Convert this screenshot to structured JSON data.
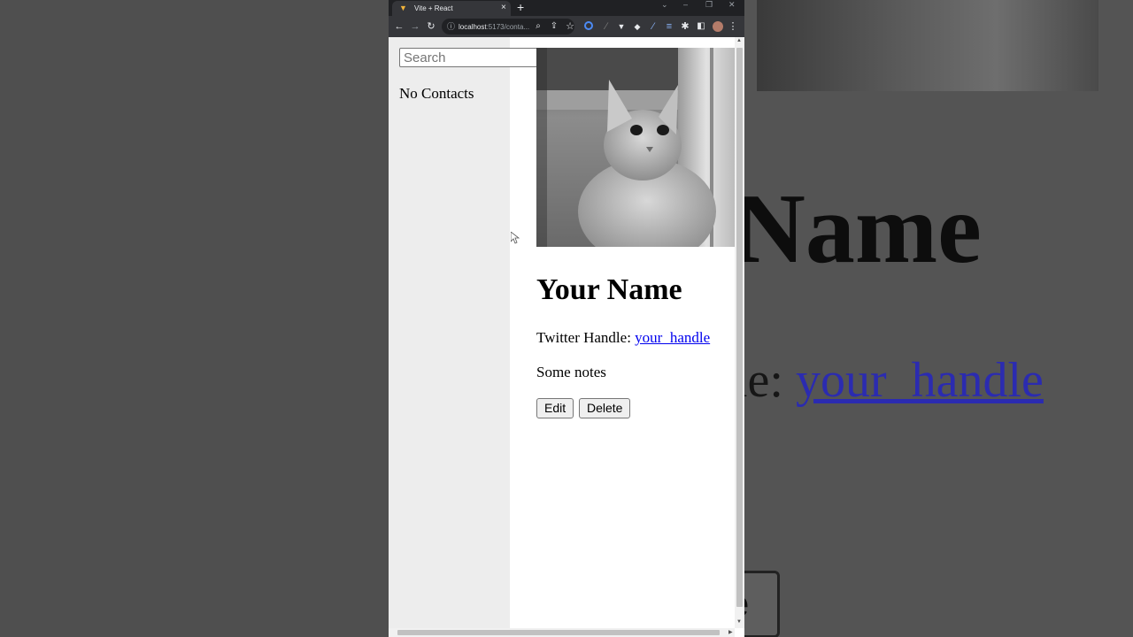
{
  "browser": {
    "tab_title": "Vite + React",
    "tab_close": "×",
    "new_tab": "+",
    "url_host": "localhost",
    "url_rest": ":5173/conta...",
    "window_minimize": "–",
    "window_restore": "❐",
    "window_close": "✕",
    "tab_search": "⌄"
  },
  "sidebar": {
    "search_placeholder": "Search",
    "empty_message": "No Contacts"
  },
  "contact": {
    "name": "Your Name",
    "twitter_label": "Twitter Handle: ",
    "twitter_handle": "your_handle",
    "notes": "Some notes",
    "edit_label": "Edit",
    "delete_label": "Delete"
  },
  "background": {
    "name_fragment": "Name",
    "handle_prefix": "le: ",
    "handle": "your_handle",
    "button_fragment": "e"
  },
  "colors": {
    "link": "#0000ee",
    "sidebar_bg": "#ededed",
    "chrome_dark": "#202124",
    "chrome_toolbar": "#35363a"
  }
}
